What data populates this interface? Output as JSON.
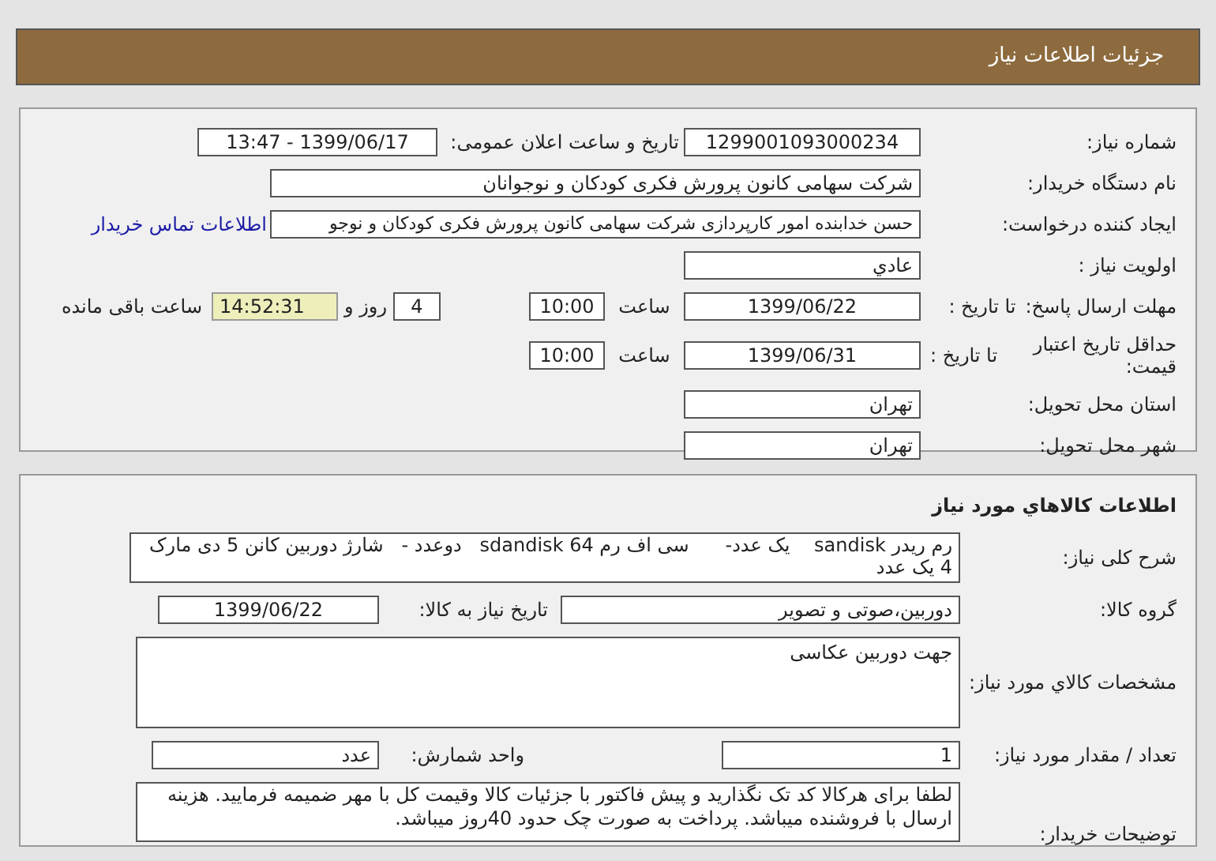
{
  "header": {
    "title": "جزئیات اطلاعات نیاز"
  },
  "details": {
    "need_number": {
      "label": "شماره نیاز:",
      "value": "1299001093000234"
    },
    "announce": {
      "label": "تاریخ و ساعت اعلان عمومی:",
      "value": "1399/06/17 - 13:47"
    },
    "buyer": {
      "label": "نام دستگاه خریدار:",
      "value": "شرکت سهامی کانون پرورش فکری کودکان و نوجوانان"
    },
    "requester": {
      "label": "ایجاد کننده درخواست:",
      "value": "حسن خدابنده امور کارپردازی  شرکت سهامی کانون پرورش فکری کودکان و نوجو",
      "link": "اطلاعات تماس خریدار"
    },
    "priority": {
      "label": "اولویت نیاز :",
      "value": "عادي"
    },
    "response_deadline": {
      "label": "مهلت ارسال پاسخ:",
      "to_label": "تا تاریخ :",
      "date": "1399/06/22",
      "time_label": "ساعت",
      "time": "10:00",
      "days": "4",
      "days_label": "روز و",
      "remaining": "14:52:31",
      "remaining_label": "ساعت باقی مانده"
    },
    "price_validity": {
      "label": "حداقل تاریخ اعتبار قیمت:",
      "to_label": "تا تاریخ :",
      "date": "1399/06/31",
      "time_label": "ساعت",
      "time": "10:00"
    },
    "province": {
      "label": "استان محل تحویل:",
      "value": "تهران"
    },
    "city": {
      "label": "شهر محل تحویل:",
      "value": "تهران"
    }
  },
  "goods": {
    "heading": "اطلاعات کالاهاي مورد نياز",
    "description": {
      "label": "شرح کلی نیاز:",
      "value": "رم ریدر sandisk    یک عدد-      سی اف رم sdandisk 64   دوعدد -   شارژ دوربین کانن 5 دی مارک 4 یک عدد"
    },
    "group": {
      "label": "گروه کالا:",
      "value": "دوربین،صوتی و تصویر",
      "date_label": "تاریخ نیاز به کالا:",
      "date": "1399/06/22"
    },
    "specs": {
      "label": "مشخصات کالاي مورد نياز:",
      "value": "جهت دوربین عکاسی"
    },
    "quantity": {
      "label": "تعداد / مقدار مورد نیاز:",
      "value": "1",
      "unit_label": "واحد شمارش:",
      "unit": "عدد"
    },
    "notes": {
      "label": "توضیحات خریدار:",
      "value": "لطفا برای هرکالا کد تک نگذارید و پیش فاکتور با جزئیات کالا وقیمت کل با مهر ضمیمه فرمایید. هزینه ارسال با فروشنده میباشد. پرداخت به صورت چک حدود 40روز میباشد."
    }
  }
}
